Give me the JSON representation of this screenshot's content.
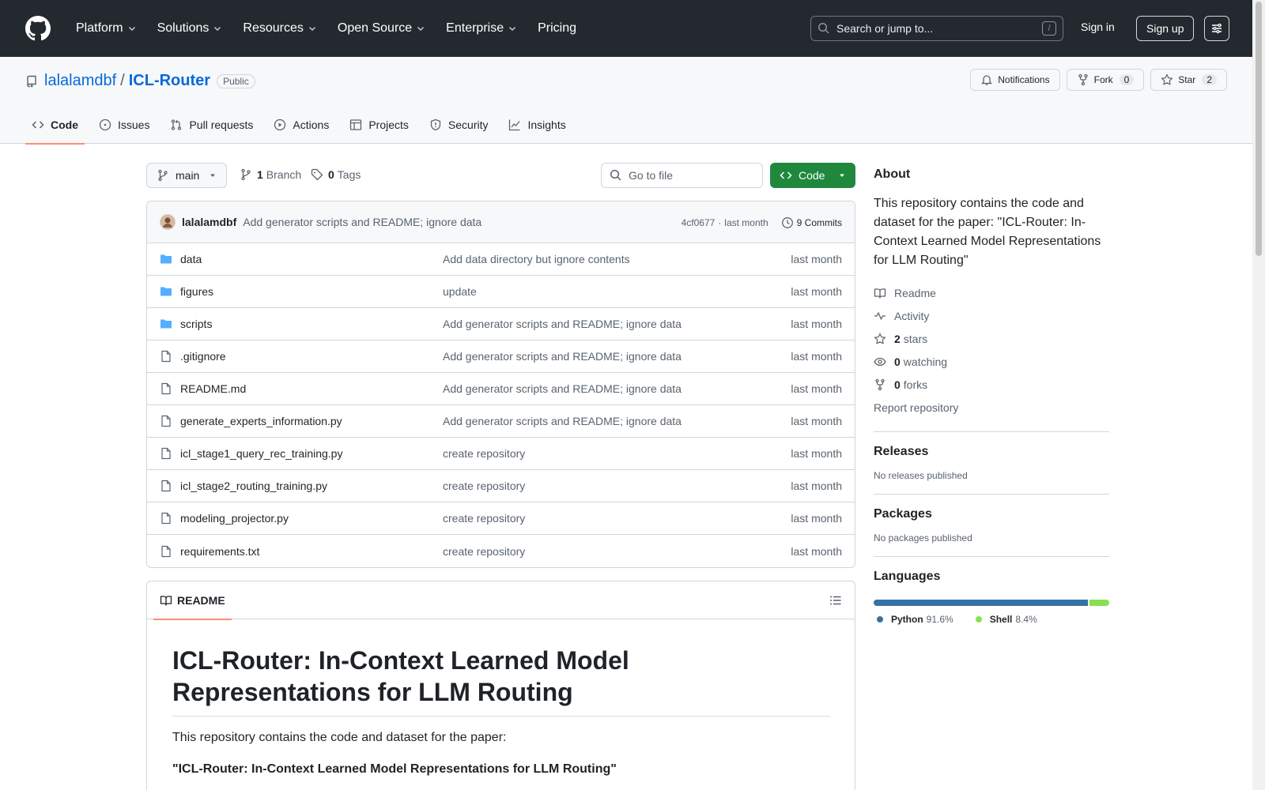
{
  "header": {
    "nav": [
      {
        "label": "Platform",
        "has_dropdown": true
      },
      {
        "label": "Solutions",
        "has_dropdown": true
      },
      {
        "label": "Resources",
        "has_dropdown": true
      },
      {
        "label": "Open Source",
        "has_dropdown": true
      },
      {
        "label": "Enterprise",
        "has_dropdown": true
      },
      {
        "label": "Pricing",
        "has_dropdown": false
      }
    ],
    "search_placeholder": "Search or jump to...",
    "search_shortcut": "/",
    "sign_in": "Sign in",
    "sign_up": "Sign up"
  },
  "repo": {
    "owner": "lalalamdbf",
    "separator": "/",
    "name": "ICL-Router",
    "visibility": "Public",
    "actions": {
      "notifications": "Notifications",
      "fork_label": "Fork",
      "fork_count": "0",
      "star_label": "Star",
      "star_count": "2"
    },
    "tabs": [
      {
        "label": "Code",
        "icon": "code-icon",
        "active": true
      },
      {
        "label": "Issues",
        "icon": "issue-icon",
        "active": false
      },
      {
        "label": "Pull requests",
        "icon": "pull-request-icon",
        "active": false
      },
      {
        "label": "Actions",
        "icon": "play-icon",
        "active": false
      },
      {
        "label": "Projects",
        "icon": "table-icon",
        "active": false
      },
      {
        "label": "Security",
        "icon": "shield-icon",
        "active": false
      },
      {
        "label": "Insights",
        "icon": "graph-icon",
        "active": false
      }
    ]
  },
  "toolbar": {
    "branch": "main",
    "branch_count": "1",
    "branch_label": "Branch",
    "tag_count": "0",
    "tag_label": "Tags",
    "goto_placeholder": "Go to file",
    "code_button": "Code"
  },
  "latest_commit": {
    "author": "lalalamdbf",
    "message": "Add generator scripts and README; ignore data",
    "hash": "4cf0677",
    "dot": "·",
    "time": "last month",
    "commit_count": "9 Commits"
  },
  "files": [
    {
      "name": "data",
      "type": "folder",
      "commit": "Add data directory but ignore contents",
      "date": "last month"
    },
    {
      "name": "figures",
      "type": "folder",
      "commit": "update",
      "date": "last month"
    },
    {
      "name": "scripts",
      "type": "folder",
      "commit": "Add generator scripts and README; ignore data",
      "date": "last month"
    },
    {
      "name": ".gitignore",
      "type": "file",
      "commit": "Add generator scripts and README; ignore data",
      "date": "last month"
    },
    {
      "name": "README.md",
      "type": "file",
      "commit": "Add generator scripts and README; ignore data",
      "date": "last month"
    },
    {
      "name": "generate_experts_information.py",
      "type": "file",
      "commit": "Add generator scripts and README; ignore data",
      "date": "last month"
    },
    {
      "name": "icl_stage1_query_rec_training.py",
      "type": "file",
      "commit": "create repository",
      "date": "last month"
    },
    {
      "name": "icl_stage2_routing_training.py",
      "type": "file",
      "commit": "create repository",
      "date": "last month"
    },
    {
      "name": "modeling_projector.py",
      "type": "file",
      "commit": "create repository",
      "date": "last month"
    },
    {
      "name": "requirements.txt",
      "type": "file",
      "commit": "create repository",
      "date": "last month"
    }
  ],
  "readme": {
    "tab_label": "README",
    "title": "ICL-Router: In-Context Learned Model Representations for LLM Routing",
    "intro": "This repository contains the code and dataset for the paper:",
    "paper_title": "\"ICL-Router: In-Context Learned Model Representations for LLM Routing\""
  },
  "sidebar": {
    "about_title": "About",
    "description": "This repository contains the code and dataset for the paper: \"ICL-Router: In-Context Learned Model Representations for LLM Routing\"",
    "links": {
      "readme": "Readme",
      "activity": "Activity",
      "stars_count": "2",
      "stars_label": "stars",
      "watching_count": "0",
      "watching_label": "watching",
      "forks_count": "0",
      "forks_label": "forks",
      "report": "Report repository"
    },
    "releases_title": "Releases",
    "releases_text": "No releases published",
    "packages_title": "Packages",
    "packages_text": "No packages published",
    "languages_title": "Languages",
    "languages": [
      {
        "name": "Python",
        "percent": "91.6%",
        "value": 91.6,
        "color": "#3572A5"
      },
      {
        "name": "Shell",
        "percent": "8.4%",
        "value": 8.4,
        "color": "#89e051"
      }
    ]
  }
}
